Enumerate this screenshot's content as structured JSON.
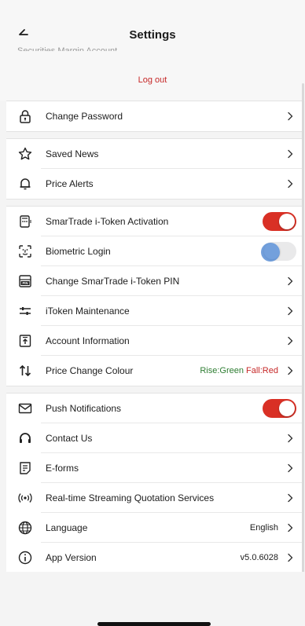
{
  "header": {
    "title": "Settings",
    "subtitle_partial": "Securities Margin Account"
  },
  "logout_label": "Log out",
  "groups": [
    {
      "items": [
        {
          "label": "Change Password",
          "icon": "lock-icon",
          "control": "chevron"
        }
      ]
    },
    {
      "items": [
        {
          "label": "Saved News",
          "icon": "star-icon",
          "control": "chevron"
        },
        {
          "label": "Price Alerts",
          "icon": "bell-icon",
          "control": "chevron"
        }
      ]
    },
    {
      "items": [
        {
          "label": "SmarTrade i-Token Activation",
          "icon": "token-device-icon",
          "control": "toggle",
          "state": "on"
        },
        {
          "label": "Biometric Login",
          "icon": "face-id-icon",
          "control": "toggle",
          "state": "off"
        },
        {
          "label": "Change SmarTrade i-Token PIN",
          "icon": "pin-device-icon",
          "control": "chevron"
        },
        {
          "label": "iToken Maintenance",
          "icon": "sliders-icon",
          "control": "chevron"
        },
        {
          "label": "Account Information",
          "icon": "account-info-icon",
          "control": "chevron"
        },
        {
          "label": "Price Change Colour",
          "icon": "up-down-arrows-icon",
          "control": "chevron",
          "rise": "Rise:Green",
          "fall": "Fall:Red"
        }
      ]
    },
    {
      "items": [
        {
          "label": "Push Notifications",
          "icon": "mail-icon",
          "control": "toggle",
          "state": "on"
        },
        {
          "label": "Contact Us",
          "icon": "headset-icon",
          "control": "chevron"
        },
        {
          "label": "E-forms",
          "icon": "form-icon",
          "control": "chevron"
        },
        {
          "label": "Real-time Streaming Quotation Services",
          "icon": "broadcast-icon",
          "control": "chevron"
        },
        {
          "label": "Language",
          "icon": "globe-icon",
          "control": "chevron",
          "value": "English"
        },
        {
          "label": "App Version",
          "icon": "info-icon",
          "control": "chevron",
          "value": "v5.0.6028"
        }
      ]
    }
  ],
  "colors": {
    "accent_red": "#d93025",
    "logout_red": "#c62828",
    "rise_green": "#2e7d32",
    "touch_blue": "#5b8fd6"
  }
}
